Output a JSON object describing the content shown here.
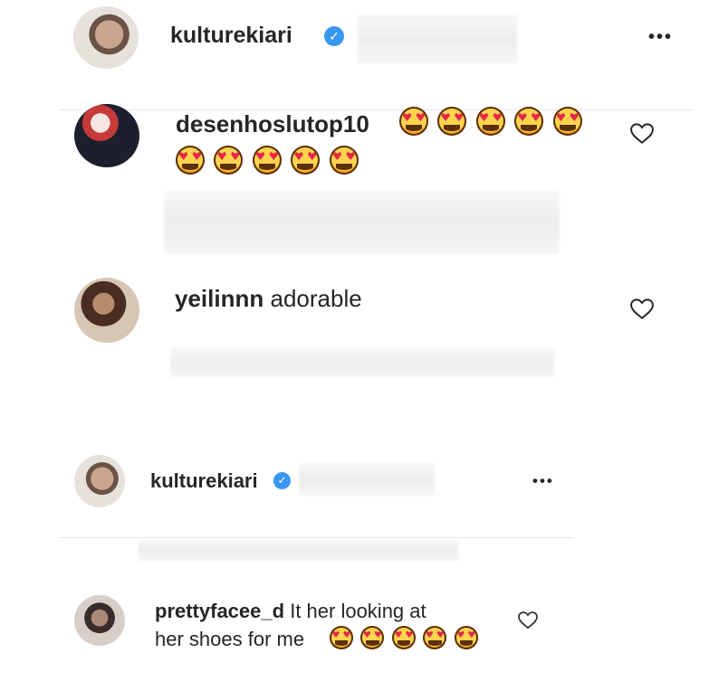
{
  "post_header": {
    "username": "kulturekiari",
    "verified_icon": "verified-check-icon",
    "more_icon": "more-options-icon",
    "more_label": "•••"
  },
  "comments": [
    {
      "username": "desenhoslutop10",
      "text": "",
      "emoji": "heart-eyes-emoji",
      "emoji_count": 10,
      "heart_icon": "heart-outline-icon"
    },
    {
      "username": "yeilinnn",
      "text": "adorable",
      "heart_icon": "heart-outline-icon"
    }
  ],
  "post_header_2": {
    "username": "kulturekiari",
    "verified_icon": "verified-check-icon",
    "more_label": "•••"
  },
  "comment_2": {
    "username": "prettyfacee_d",
    "text_line1": "It her looking at",
    "text_line2": "her shoes for me",
    "emoji": "heart-eyes-emoji",
    "emoji_count": 5,
    "heart_icon": "heart-outline-icon"
  },
  "colors": {
    "verified": "#3897f0",
    "text": "#262626",
    "divider": "#e6e6e6"
  }
}
